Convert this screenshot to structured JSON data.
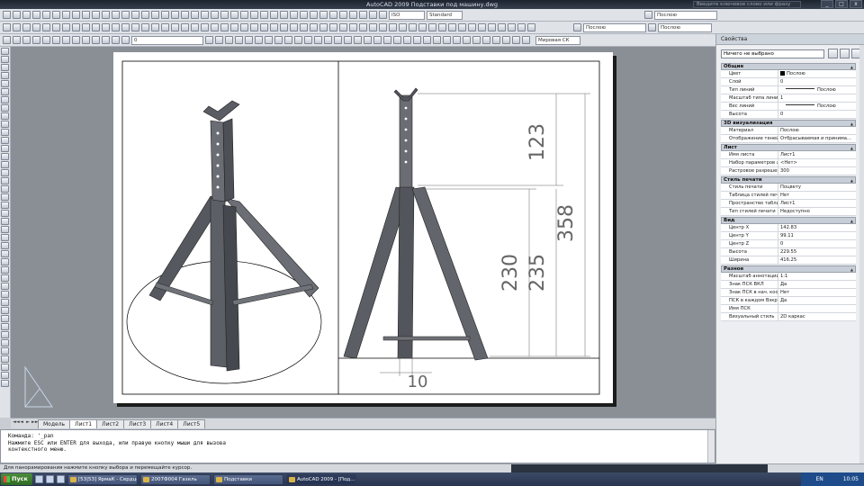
{
  "window": {
    "title_app": "AutoCAD 2009",
    "title_file": "Подставки под машину.dwg",
    "search_placeholder": "Введите ключевое слово или фразу",
    "buttons": [
      "_",
      "□",
      "x"
    ]
  },
  "toolbars": {
    "layer_combo": "0",
    "ucs_label": "Мировая СК",
    "linetype_combo": "Послою",
    "lineweight_combo": "Послою",
    "color_combo": "Послою",
    "style_combo": "ISO",
    "standard_combo": "Standard"
  },
  "tabs": [
    "Модель",
    "Лист1",
    "Лист2",
    "Лист3",
    "Лист4",
    "Лист5"
  ],
  "active_tab": "Лист1",
  "tab_nav": [
    "◄◄",
    "◄",
    "►",
    "►►"
  ],
  "command": {
    "lines": [
      "Команда: '_pan",
      "Нажмите ESC или ENTER для выхода, или правую кнопку мыши для вызова",
      "контекстного меню."
    ]
  },
  "status": {
    "text": "Для панорамирования нажмите кнопку выбора и перемещайте курсор."
  },
  "drawing": {
    "dims": [
      "123",
      "358",
      "230",
      "235",
      "10"
    ]
  },
  "properties": {
    "title": "Свойства",
    "selection": "Ничего не выбрано",
    "sections": [
      {
        "name": "Общие",
        "rows": [
          {
            "k": "Цвет",
            "v": "Послою",
            "swatch": true
          },
          {
            "k": "Слой",
            "v": "0"
          },
          {
            "k": "Тип линий",
            "v": "Послою",
            "line": true
          },
          {
            "k": "Масштаб типа линий",
            "v": "1"
          },
          {
            "k": "Вес линий",
            "v": "Послою",
            "line": true
          },
          {
            "k": "Высота",
            "v": "0"
          }
        ]
      },
      {
        "name": "3D визуализация",
        "rows": [
          {
            "k": "Материал",
            "v": "Послою"
          },
          {
            "k": "Отображение теней",
            "v": "Отбрасываемая и принима..."
          }
        ]
      },
      {
        "name": "Лист",
        "rows": [
          {
            "k": "Имя листа",
            "v": "Лист1"
          },
          {
            "k": "Набор параметров ли...",
            "v": "<Нет>"
          },
          {
            "k": "Растровое разрешение",
            "v": "300"
          }
        ]
      },
      {
        "name": "Стиль печати",
        "rows": [
          {
            "k": "Стиль печати",
            "v": "Поцвету"
          },
          {
            "k": "Таблица стилей печати",
            "v": "Нет"
          },
          {
            "k": "Пространство таблиц...",
            "v": "Лист1"
          },
          {
            "k": "Тип стилей печати",
            "v": "Недоступно"
          }
        ]
      },
      {
        "name": "Вид",
        "rows": [
          {
            "k": "Центр X",
            "v": "142.83"
          },
          {
            "k": "Центр Y",
            "v": "99.11"
          },
          {
            "k": "Центр Z",
            "v": "0"
          },
          {
            "k": "Высота",
            "v": "229.55"
          },
          {
            "k": "Ширина",
            "v": "416.25"
          }
        ]
      },
      {
        "name": "Разное",
        "rows": [
          {
            "k": "Масштаб аннотаций",
            "v": "1:1"
          },
          {
            "k": "Знак ПСК ВКЛ",
            "v": "Да"
          },
          {
            "k": "Знак ПСК в нач. коорд.",
            "v": "Нет"
          },
          {
            "k": "ПСК в каждом Вэкране",
            "v": "Да"
          },
          {
            "k": "Имя ПСК",
            "v": ""
          },
          {
            "k": "Визуальный стиль",
            "v": "2D каркас"
          }
        ]
      }
    ]
  },
  "taskbar": {
    "start": "Пуск",
    "tasks": [
      "[53|53] ЯрмаК - Сердце...",
      "2007Ф004 Газель",
      "Подставки",
      "AutoCAD 2009 - [Под..."
    ],
    "active_task": "AutoCAD 2009 - [Под...",
    "lang": "EN",
    "clock": "10:05"
  },
  "colors": {
    "canvas": "#8a8f96",
    "titlebar": "#1d2430",
    "taskbar": "#2a3550"
  }
}
